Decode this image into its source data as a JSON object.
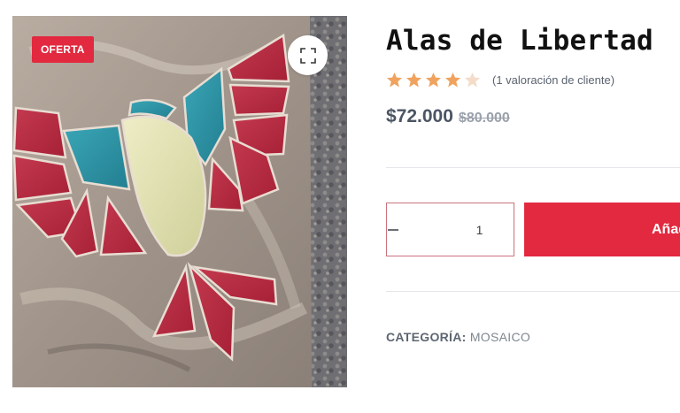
{
  "product": {
    "title": "Alas de Libertad",
    "sale_badge": "OFERTA",
    "rating": 4,
    "rating_max": 5,
    "review_text": "(1 valoración de cliente)",
    "price_current": "$72.000",
    "price_old": "$80.000",
    "quantity": "1",
    "add_to_cart_label": "Añadir al carrito",
    "category_label": "CATEGORÍA:",
    "category_value": "MOSAICO",
    "image_subject": "mosaic bird made of red, teal and cream ceramic tiles"
  },
  "colors": {
    "accent": "#e2293f",
    "star_filled": "#f0a35e",
    "star_empty": "#f4dcc9",
    "title": "#111111",
    "price": "#4b5563",
    "muted": "#9aa1ab"
  },
  "icons": {
    "zoom": "fullscreen-icon",
    "minus": "minus-icon",
    "plus": "plus-icon",
    "star": "star-icon"
  }
}
